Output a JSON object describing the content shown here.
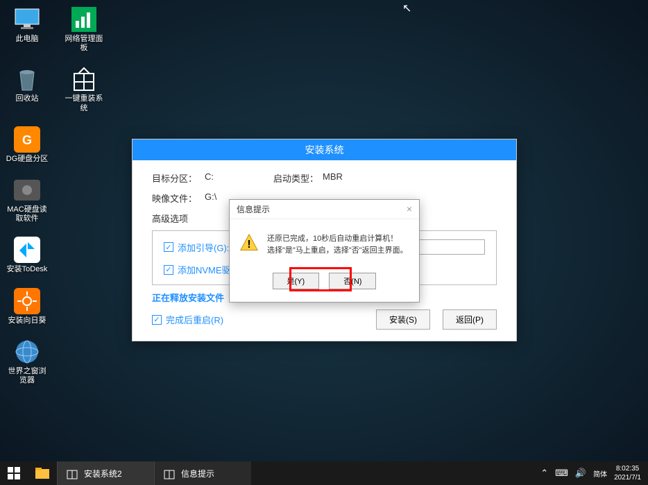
{
  "desktop": {
    "row1": [
      {
        "label": "此电脑"
      },
      {
        "label": "网络管理面板"
      }
    ],
    "row2": [
      {
        "label": "回收站"
      },
      {
        "label": "一键重装系统"
      }
    ],
    "col1": [
      {
        "label": "DG硬盘分区"
      },
      {
        "label": "MAC硬盘读取软件"
      },
      {
        "label": "安装ToDesk"
      },
      {
        "label": "安装向日葵"
      },
      {
        "label": "世界之窗浏览器"
      }
    ]
  },
  "main_window": {
    "title": "安装系统",
    "target_label": "目标分区：",
    "target_value": "C:",
    "boot_label": "启动类型：",
    "boot_value": "MBR",
    "image_label": "映像文件：",
    "image_value": "G:\\",
    "advanced_label": "高级选项",
    "cb1": "添加引导(G):",
    "cb2": "添加NVME驱",
    "status": "正在释放安装文件",
    "cb_restart": "完成后重启(R)",
    "btn_install": "安装(S)",
    "btn_back": "返回(P)"
  },
  "dialog": {
    "title": "信息提示",
    "line1": "还原已完成，10秒后自动重启计算机！",
    "line2": "选择\"是\"马上重启，选择\"否\"返回主界面。",
    "btn_yes": "是(Y)",
    "btn_no": "否(N)"
  },
  "taskbar": {
    "item1": "安装系统2",
    "item2": "信息提示",
    "ime": "简体",
    "time": "8:02:35",
    "date": "2021/7/1"
  }
}
